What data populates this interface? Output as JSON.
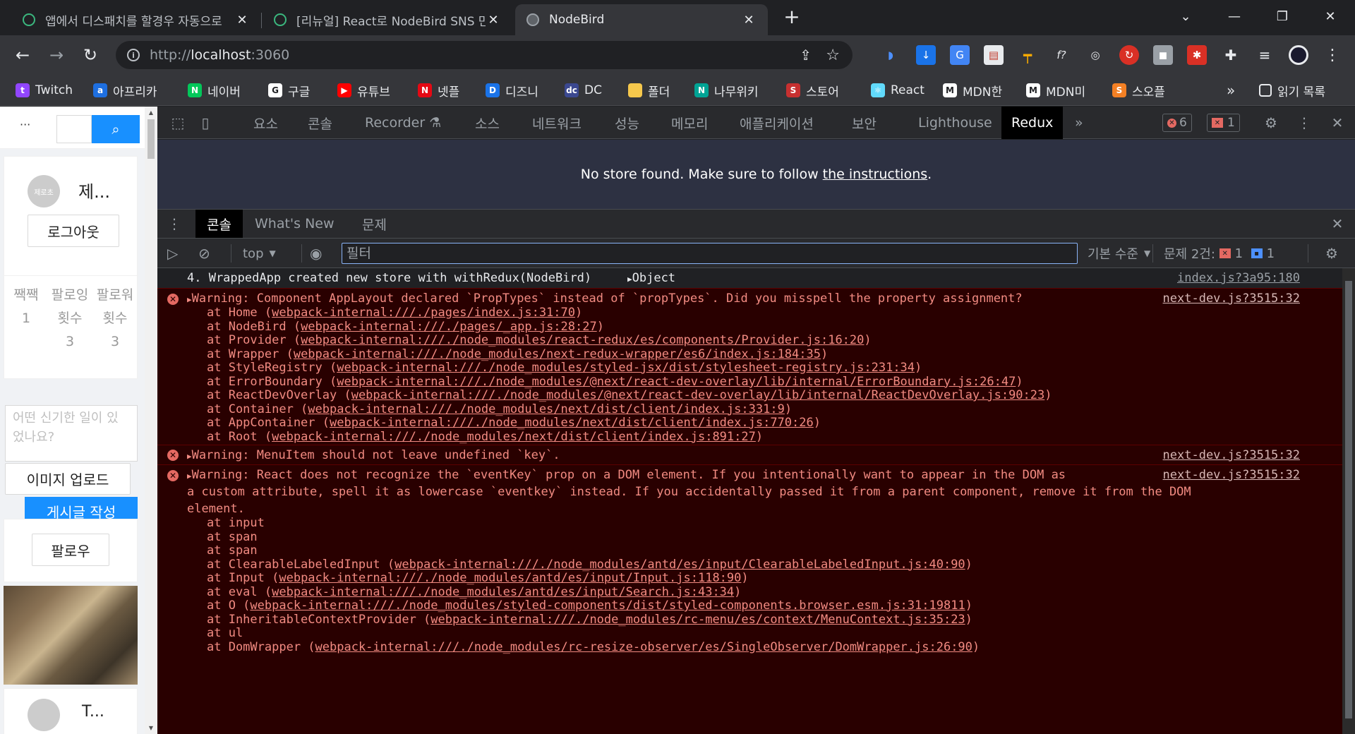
{
  "browser": {
    "tabs": [
      {
        "title": "앱에서 디스패치를 할경우 자동으로",
        "close": "✕"
      },
      {
        "title": "[리뉴얼] React로 NodeBird SNS 만들기",
        "close": "✕"
      },
      {
        "title": "NodeBird",
        "close": "✕"
      }
    ],
    "new_tab": "+",
    "window_buttons": {
      "dropdown": "⌄",
      "minimize": "—",
      "restore": "❐",
      "close": "✕"
    },
    "nav": {
      "back": "←",
      "forward": "→",
      "reload": "↻"
    },
    "url": {
      "scheme": "http://",
      "host": "localhost",
      "port": ":3060"
    },
    "bookmarks": [
      {
        "label": "Twitch",
        "icon_color": "#9146ff",
        "icon": "t"
      },
      {
        "label": "아프리카",
        "icon_color": "#1e6fe0",
        "icon": "a"
      },
      {
        "label": "네이버",
        "icon_color": "#03c75a",
        "icon": "N"
      },
      {
        "label": "구글",
        "icon_color": "#ffffff",
        "icon": "G"
      },
      {
        "label": "유튜브",
        "icon_color": "#ff0000",
        "icon": "▶"
      },
      {
        "label": "넷플",
        "icon_color": "#e50914",
        "icon": "N"
      },
      {
        "label": "디즈니",
        "icon_color": "#1a73e8",
        "icon": "D"
      },
      {
        "label": "DC",
        "icon_color": "#3b4890",
        "icon": "dc"
      },
      {
        "label": "폴더",
        "icon_color": "#f6c84c",
        "icon": ""
      },
      {
        "label": "나무위키",
        "icon_color": "#00a495",
        "icon": "N"
      },
      {
        "label": "스토어",
        "icon_color": "#c73030",
        "icon": "S"
      },
      {
        "label": "React",
        "icon_color": "#61dafb",
        "icon": "⚛"
      },
      {
        "label": "MDN한",
        "icon_color": "#ffffff",
        "icon": "M"
      },
      {
        "label": "MDN미",
        "icon_color": "#ffffff",
        "icon": "M"
      },
      {
        "label": "스오플",
        "icon_color": "#f48024",
        "icon": "S"
      }
    ],
    "bookmarks_more": "»",
    "reading_list": "읽기 목록"
  },
  "page": {
    "menu_more": "···",
    "search_placeholder": "",
    "profile": {
      "avatar_text": "제로초",
      "nickname": "제...",
      "logout": "로그아웃"
    },
    "stats": [
      {
        "label": "짹짹",
        "value": "1"
      },
      {
        "label": "팔로잉 횟수",
        "value": "3"
      },
      {
        "label": "팔로워 횟수",
        "value": "3"
      }
    ],
    "post_form": {
      "placeholder": "어떤 신기한 일이 있었나요?",
      "upload": "이미지 업로드",
      "submit": "게시글 작성"
    },
    "follow_button": "팔로우",
    "post_author_initial": "T..."
  },
  "devtools": {
    "tabs": [
      "요소",
      "콘솔",
      "Recorder",
      "소스",
      "네트워크",
      "성능",
      "메모리",
      "애플리케이션",
      "보안",
      "Lighthouse",
      "Redux"
    ],
    "more_tabs": "»",
    "error_count": "6",
    "warning_count": "1",
    "redux_message": "No store found. Make sure to follow ",
    "redux_link": "the instructions",
    "redux_period": ".",
    "drawer_tabs": [
      "콘솔",
      "What's New",
      "문제"
    ],
    "console_toolbar": {
      "context": "top",
      "filter_placeholder": "필터",
      "levels": "기본 수준",
      "issues_label": "문제 2건:",
      "issues_errors": "1",
      "issues_info": "1"
    },
    "messages": [
      {
        "type": "log",
        "text": "4. WrappedApp created new store with withRedux(NodeBird)",
        "object": "Object",
        "source": "index.js?3a95:180"
      },
      {
        "type": "error",
        "text": "Warning: Component AppLayout declared `PropTypes` instead of `propTypes`. Did you misspell the property assignment?",
        "source": "next-dev.js?3515:32",
        "stack": [
          {
            "fn": "at Home (",
            "loc": "webpack-internal:///./pages/index.js:31:70",
            "end": ")"
          },
          {
            "fn": "at NodeBird (",
            "loc": "webpack-internal:///./pages/_app.js:28:27",
            "end": ")"
          },
          {
            "fn": "at Provider (",
            "loc": "webpack-internal:///./node_modules/react-redux/es/components/Provider.js:16:20",
            "end": ")"
          },
          {
            "fn": "at Wrapper (",
            "loc": "webpack-internal:///./node_modules/next-redux-wrapper/es6/index.js:184:35",
            "end": ")"
          },
          {
            "fn": "at StyleRegistry (",
            "loc": "webpack-internal:///./node_modules/styled-jsx/dist/stylesheet-registry.js:231:34",
            "end": ")"
          },
          {
            "fn": "at ErrorBoundary (",
            "loc": "webpack-internal:///./node_modules/@next/react-dev-overlay/lib/internal/ErrorBoundary.js:26:47",
            "end": ")"
          },
          {
            "fn": "at ReactDevOverlay (",
            "loc": "webpack-internal:///./node_modules/@next/react-dev-overlay/lib/internal/ReactDevOverlay.js:90:23",
            "end": ")"
          },
          {
            "fn": "at Container (",
            "loc": "webpack-internal:///./node_modules/next/dist/client/index.js:331:9",
            "end": ")"
          },
          {
            "fn": "at AppContainer (",
            "loc": "webpack-internal:///./node_modules/next/dist/client/index.js:770:26",
            "end": ")"
          },
          {
            "fn": "at Root (",
            "loc": "webpack-internal:///./node_modules/next/dist/client/index.js:891:27",
            "end": ")"
          }
        ]
      },
      {
        "type": "error",
        "text": "Warning: MenuItem should not leave undefined `key`.",
        "source": "next-dev.js?3515:32",
        "stack": []
      },
      {
        "type": "error",
        "text_lines": [
          "Warning: React does not recognize the `eventKey` prop on a DOM element. If you intentionally want to appear in the DOM as",
          "a custom attribute, spell it as lowercase `eventkey` instead. If you accidentally passed it from a parent component, remove it from the DOM",
          "element."
        ],
        "source": "next-dev.js?3515:32",
        "stack": [
          {
            "fn": "at input",
            "loc": "",
            "end": ""
          },
          {
            "fn": "at span",
            "loc": "",
            "end": ""
          },
          {
            "fn": "at span",
            "loc": "",
            "end": ""
          },
          {
            "fn": "at ClearableLabeledInput (",
            "loc": "webpack-internal:///./node_modules/antd/es/input/ClearableLabeledInput.js:40:90",
            "end": ")"
          },
          {
            "fn": "at Input (",
            "loc": "webpack-internal:///./node_modules/antd/es/input/Input.js:118:90",
            "end": ")"
          },
          {
            "fn": "at eval (",
            "loc": "webpack-internal:///./node_modules/antd/es/input/Search.js:43:34",
            "end": ")"
          },
          {
            "fn": "at O (",
            "loc": "webpack-internal:///./node_modules/styled-components/dist/styled-components.browser.esm.js:31:19811",
            "end": ")"
          },
          {
            "fn": "at InheritableContextProvider (",
            "loc": "webpack-internal:///./node_modules/rc-menu/es/context/MenuContext.js:35:23",
            "end": ")"
          },
          {
            "fn": "at ul",
            "loc": "",
            "end": ""
          },
          {
            "fn": "at DomWrapper (",
            "loc": "webpack-internal:///./node_modules/rc-resize-observer/es/SingleObserver/DomWrapper.js:26:90",
            "end": ")"
          }
        ]
      }
    ]
  },
  "colors": {
    "accent": "#1890ff",
    "error_text": "#f28b82",
    "error_bg": "#290000",
    "redux_bg": "#2d3142"
  }
}
